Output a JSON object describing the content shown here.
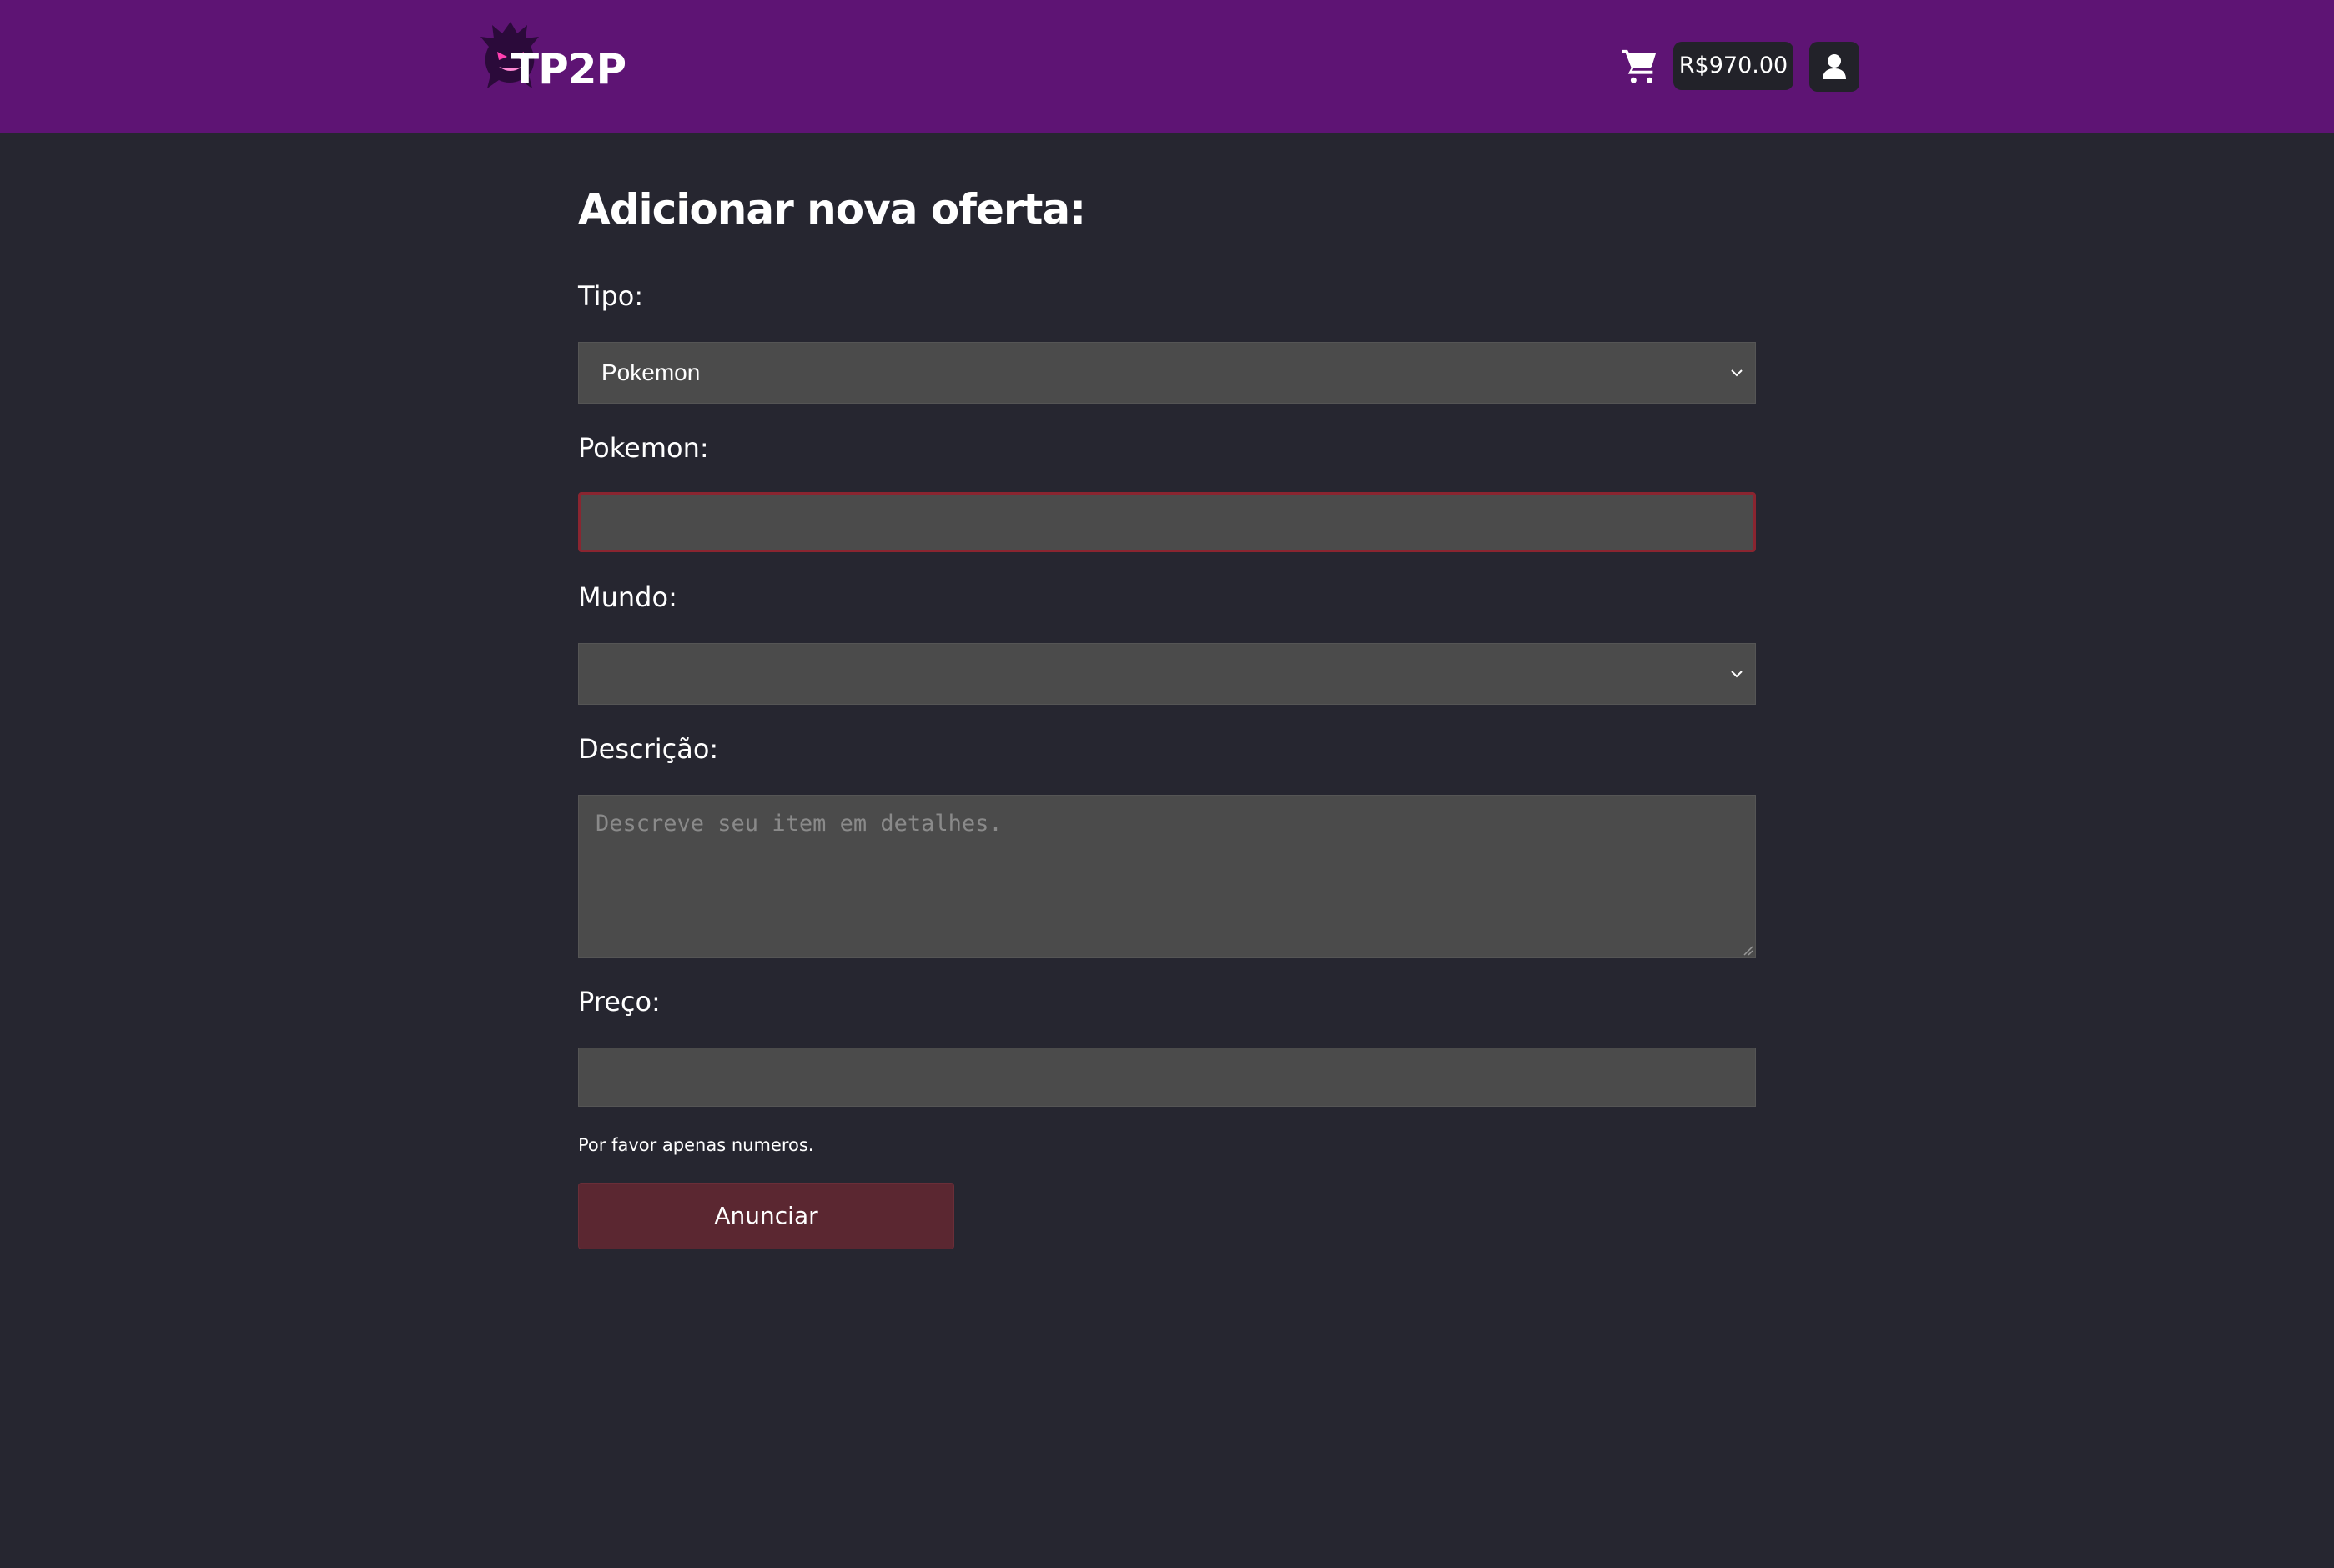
{
  "brand": {
    "name": "TP2P",
    "logo_icon": "ghost-mascot-icon"
  },
  "header": {
    "cart_icon": "cart-icon",
    "balance": "R$970.00",
    "user_icon": "user-icon"
  },
  "form": {
    "title": "Adicionar nova oferta:",
    "tipo": {
      "label": "Tipo:",
      "value": "Pokemon"
    },
    "pokemon": {
      "label": "Pokemon:",
      "value": ""
    },
    "mundo": {
      "label": "Mundo:",
      "value": ""
    },
    "descricao": {
      "label": "Descrição:",
      "placeholder": "Descreve seu item em detalhes."
    },
    "preco": {
      "label": "Preço:",
      "value": "",
      "hint": "Por favor apenas numeros."
    },
    "submit_label": "Anunciar"
  },
  "colors": {
    "header_bg": "#5e1474",
    "page_bg": "#262630",
    "field_bg": "#4b4b4b",
    "error_border": "#8a2530",
    "submit_bg": "#5b2731"
  }
}
